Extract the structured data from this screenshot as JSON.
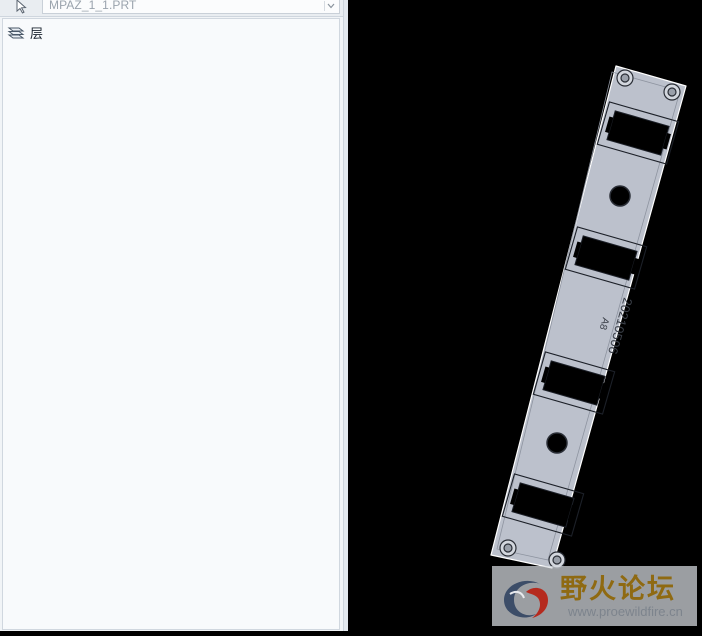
{
  "toolbar": {
    "selector_icon": "cursor-arrow-icon",
    "model_name": "MPAZ_1_1.PRT",
    "dropdown_icon": "chevron-down-icon"
  },
  "tree": {
    "items": [
      {
        "label": "层",
        "icon": "layers-icon"
      }
    ]
  },
  "viewport": {
    "background": "#000000",
    "part_color": "#bcc1cc",
    "engraving": "20210506",
    "engraving_mark": "A8"
  },
  "watermark": {
    "title": "野火论坛",
    "url": "www.proewildfire.cn"
  }
}
